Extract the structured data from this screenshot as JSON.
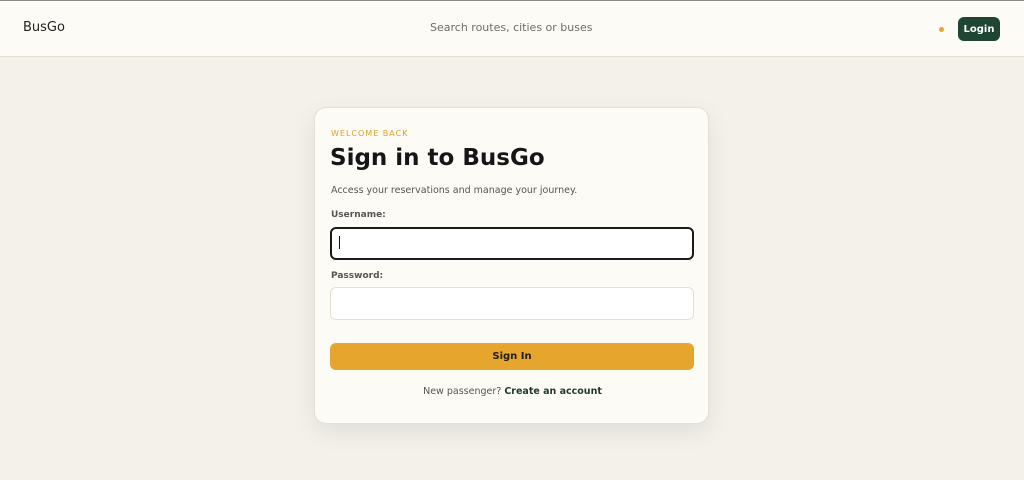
{
  "header": {
    "brand": "BusGo",
    "search_placeholder": "Search routes, cities or buses",
    "login_label": "Login"
  },
  "card": {
    "eyebrow": "WELCOME BACK",
    "title": "Sign in to BusGo",
    "subtitle": "Access your reservations and manage your journey.",
    "username_label": "Username:",
    "username_value": "",
    "password_label": "Password:",
    "password_value": "",
    "submit_label": "Sign In",
    "footer_prompt": "New passenger?",
    "footer_link": "Create an account"
  },
  "colors": {
    "accent": "#e6a52d",
    "brand_dark": "#1f4535",
    "background": "#f3f1ea"
  }
}
